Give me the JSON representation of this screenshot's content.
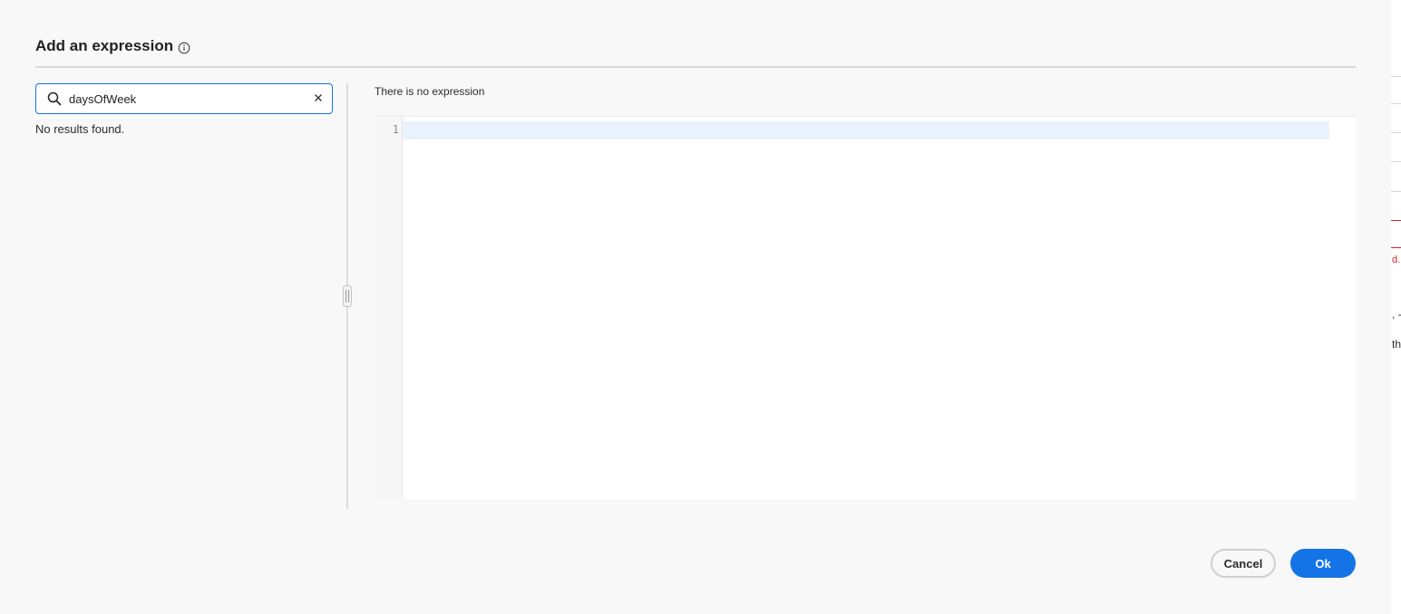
{
  "dialog": {
    "title": "Add an expression",
    "info_icon": "info-icon"
  },
  "search": {
    "value": "daysOfWeek",
    "placeholder": "",
    "search_icon": "search-icon",
    "clear_icon": "close-icon"
  },
  "results": {
    "empty_message": "No results found."
  },
  "editor": {
    "status": "There is no expression",
    "line_numbers": [
      "1"
    ]
  },
  "footer": {
    "cancel_label": "Cancel",
    "ok_label": "Ok"
  },
  "background_fragments": {
    "error_fragment": "d.",
    "fragment_1": ", -",
    "fragment_2": "th"
  },
  "colors": {
    "accent": "#1473e6",
    "error": "#c9252d",
    "dialog_bg": "#f8f8f8"
  }
}
